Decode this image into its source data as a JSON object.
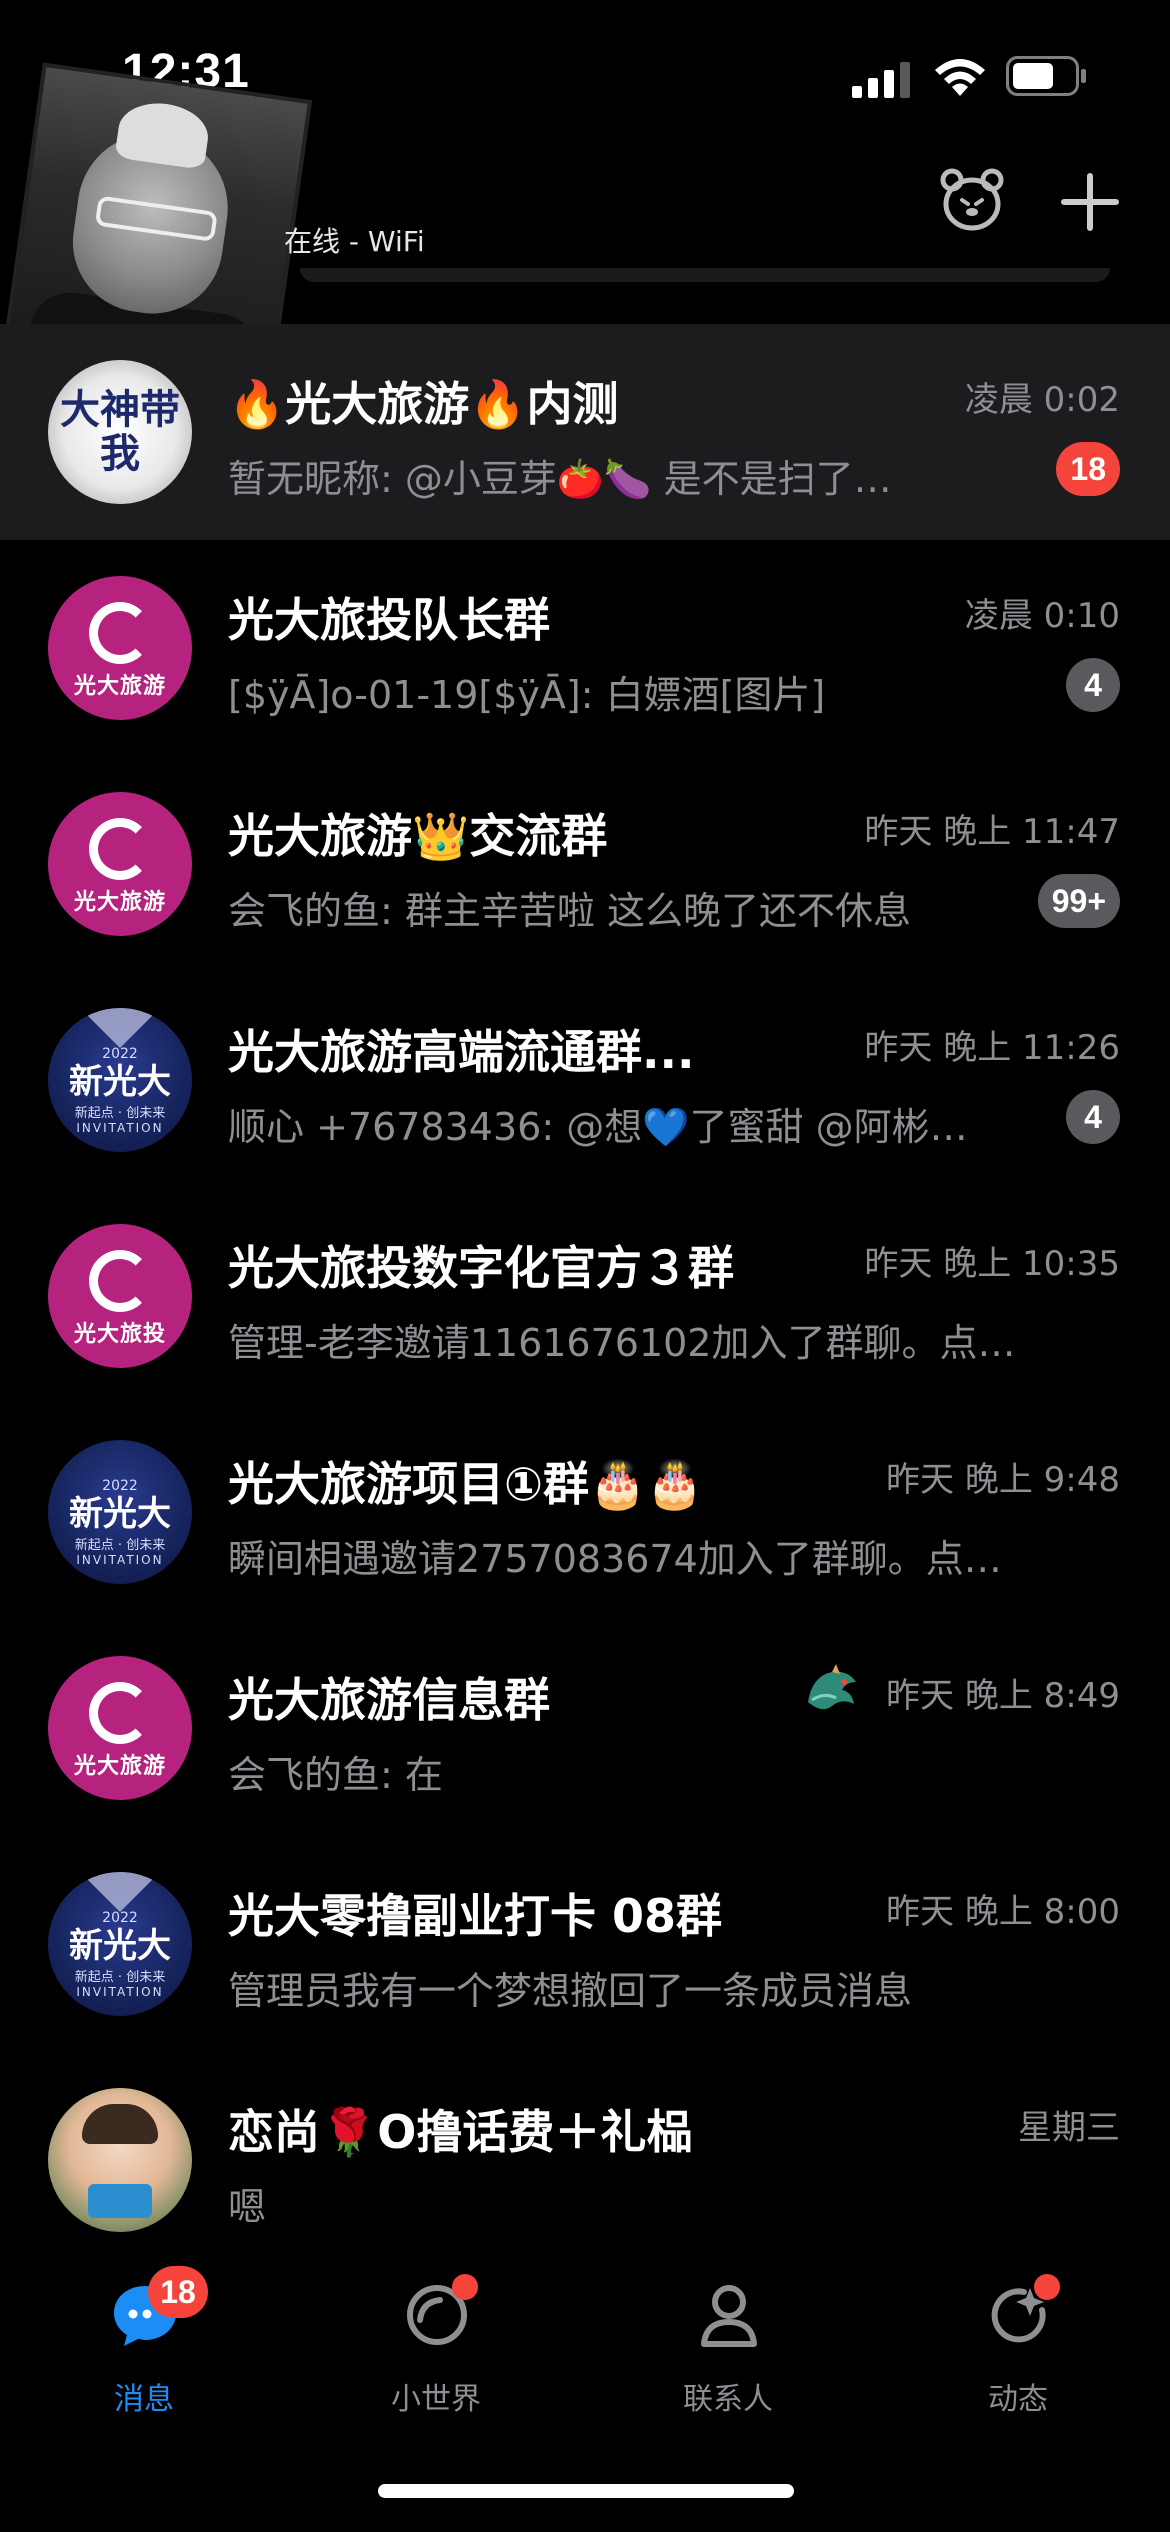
{
  "status_bar": {
    "time": "12:31"
  },
  "header": {
    "online_status": "在线 - WiFi"
  },
  "chats": [
    {
      "title": "🔥光大旅游🔥内测",
      "time": "凌晨 0:02",
      "preview": "暂无昵称: @小豆芽🍅🍆 是不是扫了…",
      "badge": "18",
      "badge_color": "#f5443b",
      "avatar_label": "大神带我",
      "pinned": true
    },
    {
      "title": "光大旅投队长群",
      "time": "凌晨 0:10",
      "preview": "[$ÿĀ]o-01-19[$ÿĀ]: 白嫖酒[图片]",
      "badge": "4",
      "badge_color": "#5a5a5e",
      "avatar_label": "光大旅游"
    },
    {
      "title": "光大旅游👑交流群",
      "time": "昨天 晚上 11:47",
      "preview": "会飞的鱼: 群主辛苦啦 这么晚了还不休息",
      "badge": "99+",
      "badge_color": "#5a5a5e",
      "avatar_label": "光大旅游"
    },
    {
      "title": "光大旅游高端流通群...",
      "time": "昨天 晚上 11:26",
      "preview": "顺心 +76783436: @想💙了蜜甜 @阿彬…",
      "badge": "4",
      "badge_color": "#5a5a5e",
      "avatar_label": {
        "year": "2022",
        "main": "新光大",
        "sub": "新起点 · 创未来",
        "inv": "INVITATION"
      }
    },
    {
      "title": "光大旅投数字化官方３群",
      "time": "昨天 晚上 10:35",
      "preview": "管理-老李邀请1161676102加入了群聊。点…",
      "badge": "",
      "avatar_label": "光大旅投"
    },
    {
      "title": "光大旅游项目①群🎂🎂",
      "time": "昨天 晚上 9:48",
      "preview": "瞬间相遇邀请2757083674加入了群聊。点…",
      "badge": "",
      "avatar_label": {
        "year": "2022",
        "main": "新光大",
        "sub": "新起点 · 创未来",
        "inv": "INVITATION"
      }
    },
    {
      "title": "光大旅游信息群",
      "time": "昨天 晚上 8:49",
      "preview": "会飞的鱼: 在",
      "badge": "",
      "avatar_label": "光大旅游",
      "icon": "dragon-icon"
    },
    {
      "title": "光大零撸副业打卡 08群",
      "time": "昨天 晚上 8:00",
      "preview": "管理员我有一个梦想撤回了一条成员消息",
      "badge": "",
      "avatar_label": {
        "year": "2022",
        "main": "新光大",
        "sub": "新起点 · 创未来",
        "inv": "INVITATION"
      }
    },
    {
      "title": "恋尚🌹O撸话费＋礼榀",
      "time": "星期三",
      "preview": "嗯",
      "badge": ""
    }
  ],
  "tabs": [
    {
      "label": "消息",
      "badge": "18",
      "active": true,
      "icon": "message-bubble-icon"
    },
    {
      "label": "小世界",
      "dot": true,
      "icon": "world-ring-icon"
    },
    {
      "label": "联系人",
      "icon": "contacts-person-icon"
    },
    {
      "label": "动态",
      "dot": true,
      "icon": "feed-star-icon"
    }
  ],
  "colors": {
    "accent": "#1d8df6",
    "badge_red": "#f5443b",
    "badge_gray": "#5a5a5e",
    "muted": "#8e8e93"
  }
}
